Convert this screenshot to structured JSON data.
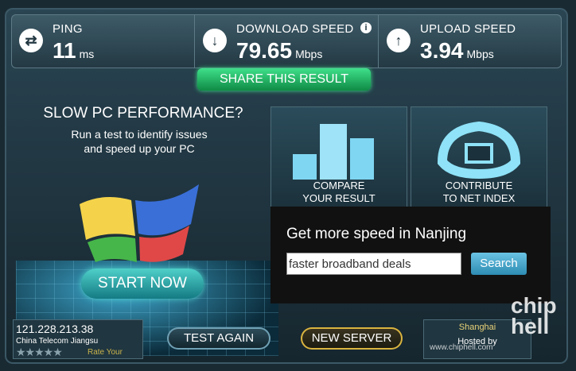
{
  "stats": {
    "ping": {
      "label": "PING",
      "value": "11",
      "unit": "ms",
      "icon": "ping-arrows-icon"
    },
    "download": {
      "label": "DOWNLOAD SPEED",
      "value": "79.65",
      "unit": "Mbps",
      "icon": "download-arrow-icon",
      "info": "i"
    },
    "upload": {
      "label": "UPLOAD SPEED",
      "value": "3.94",
      "unit": "Mbps",
      "icon": "upload-arrow-icon"
    }
  },
  "share_label": "SHARE THIS RESULT",
  "ad": {
    "title": "SLOW PC PERFORMANCE?",
    "subtitle_line1": "Run a test to identify issues",
    "subtitle_line2": "and speed up your PC",
    "start_label": "START NOW"
  },
  "panels": {
    "compare_line1": "COMPARE",
    "compare_line2": "YOUR RESULT",
    "contribute_line1": "CONTRIBUTE",
    "contribute_line2": "TO NET INDEX"
  },
  "getmore": {
    "title": "Get more speed in Nanjing",
    "input_value": "faster broadband deals",
    "search_label": "Search"
  },
  "bottom": {
    "ip": "121.228.213.38",
    "isp": "China Telecom Jiangsu",
    "rate_label": "Rate Your",
    "stars": "★★★★★",
    "test_again": "TEST AGAIN",
    "new_server": "NEW SERVER",
    "city": "Shanghai",
    "hosted_by": "Hosted by"
  },
  "watermark": {
    "logo": "chip\nhell",
    "url": "www.chiphell.com"
  }
}
